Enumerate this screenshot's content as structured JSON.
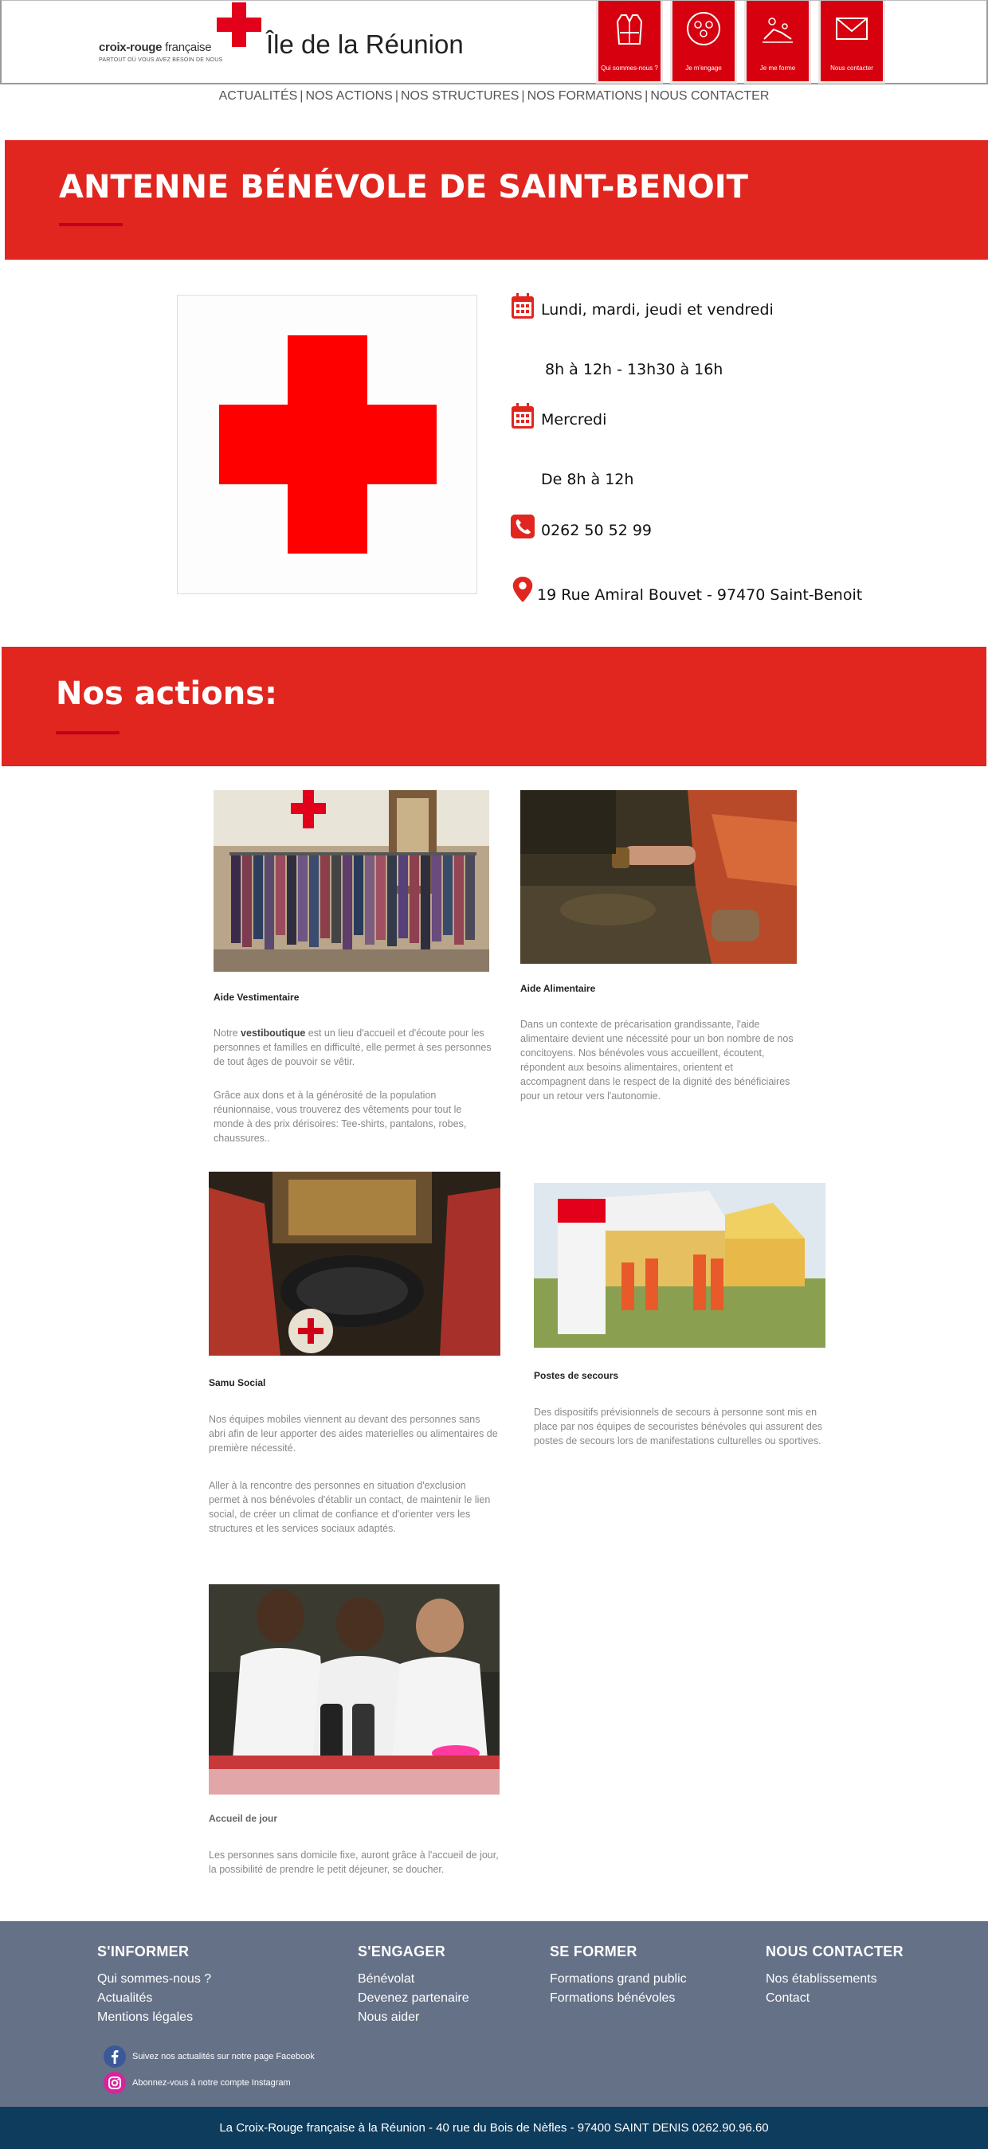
{
  "brand": {
    "name_bold": "croix-rouge",
    "name_light": " française",
    "tagline": "PARTOUT OÙ VOUS AVEZ BESOIN DE NOUS",
    "region": "Île de la Réunion",
    "color_red": "#e2001a"
  },
  "tiles": [
    {
      "label": "Qui sommes-nous ?",
      "icon": "vest-icon"
    },
    {
      "label": "Je m'engage",
      "icon": "people-icon"
    },
    {
      "label": "Je me forme",
      "icon": "first-aid-training-icon"
    },
    {
      "label": "Nous contacter",
      "icon": "envelope-icon"
    }
  ],
  "subnav": {
    "items": [
      "ACTUALITÉS",
      "NOS ACTIONS",
      "NOS STRUCTURES",
      "NOS FORMATIONS",
      "NOUS CONTACTER"
    ],
    "separator": "|"
  },
  "banner1": {
    "title": "ANTENNE BÉNÉVOLE DE SAINT-BENOIT"
  },
  "info": {
    "days1": "Lundi, mardi, jeudi et vendredi",
    "hours1": "8h à 12h - 13h30 à 16h",
    "days2": "Mercredi",
    "hours2": "De 8h à 12h",
    "phone": "0262 50 52 99",
    "address": "19 Rue Amiral Bouvet - 97470 Saint-Benoit"
  },
  "banner2": {
    "title": "Nos actions:"
  },
  "actions": [
    {
      "title": "Aide Vestimentaire",
      "p1_pre": "Notre ",
      "p1_bold": "vestiboutique",
      "p1_post": " est un lieu d'accueil et d'écoute pour les personnes et familles en difficulté, elle permet à ses personnes de tout âges de pouvoir se vêtir.",
      "p2": "Grâce aux dons et à la générosité de la population réunionnaise, vous trouverez des vêtements pour tout le monde à des prix dérisoires: Tee-shirts, pantalons, robes, chaussures.."
    },
    {
      "title": "Aide Alimentaire",
      "p1": "Dans un contexte de précarisation grandissante, l'aide alimentaire devient une nécessité pour un bon nombre de nos concitoyens. Nos bénévoles vous accueillent, écoutent, répondent aux besoins alimentaires, orientent et accompagnent dans le respect de la dignité des bénéficiaires pour un retour vers l'autonomie."
    },
    {
      "title": "Samu Social",
      "p1": "Nos équipes mobiles viennent au devant des personnes sans abri afin de leur apporter des aides materielles ou alimentaires de première nécessité.",
      "p2": "Aller à la rencontre des personnes en situation d'exclusion permet à nos bénévoles d'établir un contact, de maintenir le lien social, de créer un climat de confiance et d'orienter vers les structures et les services sociaux adaptés."
    },
    {
      "title": "Postes de secours",
      "p1": "Des dispositifs prévisionnels de secours à personne sont mis en place par nos équipes de secouristes bénévoles qui assurent des postes de secours lors de manifestations culturelles ou sportives."
    },
    {
      "title": "Accueil de jour",
      "p1": "Les personnes sans domicile fixe, auront grâce à l'accueil de jour, la possibilité de prendre le petit déjeuner, se doucher."
    }
  ],
  "footer": {
    "col1": {
      "title": "S'INFORMER",
      "links": [
        "Qui sommes-nous ?",
        "Actualités",
        "Mentions légales"
      ]
    },
    "col2": {
      "title": "S'ENGAGER",
      "links": [
        "Bénévolat",
        "Devenez partenaire",
        "Nous aider"
      ]
    },
    "col3": {
      "title": "SE FORMER",
      "links": [
        "Formations grand public",
        "Formations bénévoles"
      ]
    },
    "col4": {
      "title": "NOUS CONTACTER",
      "links": [
        "Nos établissements",
        "Contact"
      ]
    },
    "facebook": "Suivez nos actualités sur notre page Facebook",
    "instagram": "Abonnez-vous à notre compte Instagram",
    "bottom": "La Croix-Rouge française à la Réunion - 40 rue du Bois de Nèfles - 97400 SAINT DENIS 0262.90.96.60"
  }
}
